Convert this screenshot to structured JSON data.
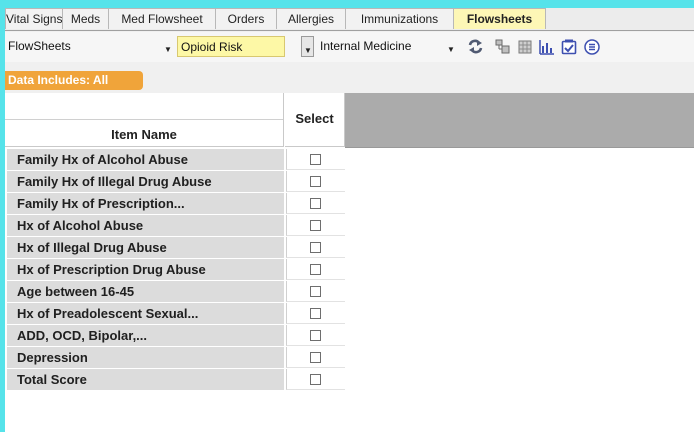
{
  "tabs": [
    {
      "label": "Vital Signs",
      "active": false
    },
    {
      "label": "Meds",
      "active": false
    },
    {
      "label": "Med Flowsheet",
      "active": false
    },
    {
      "label": "Orders",
      "active": false
    },
    {
      "label": "Allergies",
      "active": false
    },
    {
      "label": "Immunizations",
      "active": false
    },
    {
      "label": "Flowsheets",
      "active": true
    }
  ],
  "toolbar": {
    "flowsheet_select": "FlowSheets",
    "template_select": "Opioid Risk",
    "specialty_select": "Internal Medicine",
    "icons": [
      "refresh-icon",
      "layout-icon",
      "grid-icon",
      "chart-icon",
      "checklist-icon",
      "menu-icon"
    ]
  },
  "data_includes": "Data Includes: All",
  "grid": {
    "col_item": "Item Name",
    "col_select": "Select",
    "rows": [
      {
        "name": "Family Hx of Alcohol Abuse",
        "selected": false
      },
      {
        "name": "Family Hx of Illegal Drug Abuse",
        "selected": false
      },
      {
        "name": "Family Hx of Prescription...",
        "selected": false
      },
      {
        "name": "Hx of Alcohol Abuse",
        "selected": false
      },
      {
        "name": "Hx of Illegal Drug Abuse",
        "selected": false
      },
      {
        "name": "Hx of Prescription Drug Abuse",
        "selected": false
      },
      {
        "name": "Age between 16-45",
        "selected": false
      },
      {
        "name": "Hx of Preadolescent Sexual...",
        "selected": false
      },
      {
        "name": "ADD, OCD, Bipolar,...",
        "selected": false
      },
      {
        "name": "Depression",
        "selected": false
      },
      {
        "name": "Total Score",
        "selected": false
      }
    ]
  },
  "colors": {
    "background": "#56e3ea",
    "active_tab": "#fdf7b6",
    "template_highlight": "#fdf8a6",
    "data_includes_badge": "#f0a43a",
    "row_fill": "#dcdcdc"
  }
}
